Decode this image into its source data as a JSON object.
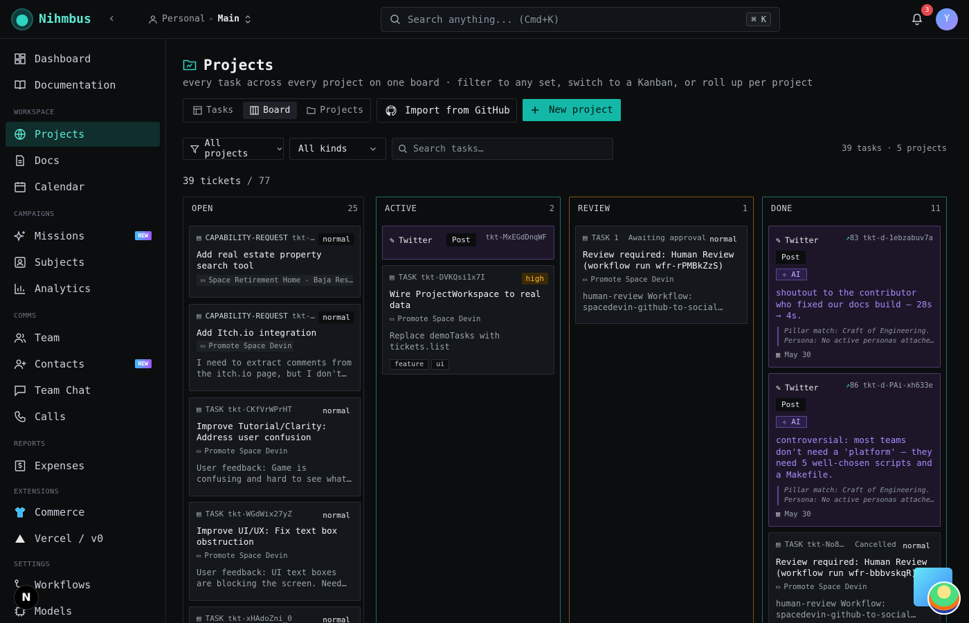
{
  "header": {
    "brand": "Nihmbus",
    "workspace": "Personal",
    "branch": "Main",
    "search_placeholder": "Search anything... (Cmd+K)",
    "shortcut": "⌘ K",
    "notifications": "3",
    "avatar_initial": "Y"
  },
  "sidebar": {
    "dashboard": "Dashboard",
    "documentation": "Documentation",
    "workspace_section": "WORKSPACE",
    "projects": "Projects",
    "docs": "Docs",
    "calendar": "Calendar",
    "campaigns_section": "CAMPAIGNS",
    "missions": "Missions",
    "new_badge": "NEW",
    "subjects": "Subjects",
    "analytics": "Analytics",
    "comms_section": "COMMS",
    "team": "Team",
    "contacts": "Contacts",
    "team_chat": "Team Chat",
    "calls": "Calls",
    "reports_section": "REPORTS",
    "expenses": "Expenses",
    "extensions_section": "EXTENSIONS",
    "commerce": "Commerce",
    "vercel": "Vercel / v0",
    "settings_section": "SETTINGS",
    "workflows": "Workflows",
    "models": "Models",
    "next_badge": "N"
  },
  "page": {
    "title": "Projects",
    "subtitle": "every task across every project on one board · filter to any set, switch to a Kanban, or roll up per project",
    "tab_tasks": "Tasks",
    "tab_board": "Board",
    "tab_projects": "Projects",
    "import_label": "Import from GitHub",
    "new_project_label": "New project",
    "filter_projects": "All projects",
    "filter_kinds": "All kinds",
    "search_placeholder": "Search tasks…",
    "summary": "39 tasks · 5 projects",
    "ticket_shown": "39 tickets",
    "ticket_total": "/ 77"
  },
  "columns": {
    "open": {
      "name": "OPEN",
      "count": "25"
    },
    "active": {
      "name": "ACTIVE",
      "count": "2"
    },
    "review": {
      "name": "REVIEW",
      "count": "1"
    },
    "done": {
      "name": "DONE",
      "count": "11"
    }
  },
  "open_cards": [
    {
      "kind": "CAPABILITY-REQUEST",
      "id": "tkt-…",
      "priority": "normal",
      "title": "Add real estate property search tool",
      "project": "Space Retirement Home - Baja Res…",
      "desc": ""
    },
    {
      "kind": "CAPABILITY-REQUEST",
      "id": "tkt-…",
      "priority": "normal",
      "title": "Add Itch.io integration",
      "project": "Promote Space Devin",
      "desc": "I need to extract comments from the itch.io page, but I don't…"
    },
    {
      "kind": "TASK",
      "id": "tkt-CKfVrWPrHT",
      "priority": "normal",
      "title": "Improve Tutorial/Clarity: Address user confusion",
      "project": "Promote Space Devin",
      "desc": "User feedback: Game is confusing and hard to see what…"
    },
    {
      "kind": "TASK",
      "id": "tkt-WGdWix27yZ",
      "priority": "normal",
      "title": "Improve UI/UX: Fix text box obstruction",
      "project": "Promote Space Devin",
      "desc": "User feedback: UI text boxes are blocking the screen. Need…"
    },
    {
      "kind": "TASK",
      "id": "tkt-xHAdoZni_0",
      "priority": "normal",
      "title": "",
      "project": "",
      "desc": ""
    }
  ],
  "active_cards": {
    "social": {
      "network": "Twitter",
      "format": "Post",
      "id": "tkt-MxEGdDnqWF"
    },
    "task": {
      "kind": "TASK",
      "id": "tkt-DVKQsi1x7I",
      "priority": "high",
      "title": "Wire ProjectWorkspace to real data",
      "project": "Promote Space Devin",
      "desc": "Replace demoTasks with tickets.list",
      "tags": [
        "feature",
        "ui"
      ]
    }
  },
  "review_cards": [
    {
      "kind": "TASK",
      "id": "1",
      "status": "Awaiting approval",
      "priority": "normal",
      "title": "Review required: Human Review (workflow run wfr-rPMBkZzS)",
      "project": "Promote Space Devin",
      "desc": "human-review Workflow: spacedevin-github-to-social…"
    }
  ],
  "done_cards": [
    {
      "network": "Twitter",
      "score": "83",
      "id": "tkt-d-1ebzabuv7a",
      "format": "Post",
      "ai": "AI",
      "text": "shoutout to the contributor who fixed our docs build — 28s → 4s.",
      "note1": "Pillar match: Craft of Engineering.",
      "note2": "Persona: No active personas attache…",
      "date": "May 30"
    },
    {
      "network": "Twitter",
      "score": "86",
      "id": "tkt-d-PAi-xh633e",
      "format": "Post",
      "ai": "AI",
      "text": "controversial: most teams don't need a 'platform' — they need 5 well-chosen scripts and a Makefile.",
      "note1": "Pillar match: Craft of Engineering.",
      "note2": "Persona: No active personas attache…",
      "date": "May 30"
    },
    {
      "kind": "TASK",
      "id": "tkt-No8…",
      "status": "Cancelled",
      "priority": "normal",
      "title": "Review required: Human Review (workflow run wfr-bbbvskqR)",
      "project": "Promote Space Devin",
      "desc": "human-review Workflow: spacedevin-github-to-social…"
    }
  ],
  "colors": {
    "accent": "#14b8a6",
    "accent_text": "#5eead4",
    "review_border": "#7a5a12",
    "ai_purple": "#a78bfa"
  }
}
